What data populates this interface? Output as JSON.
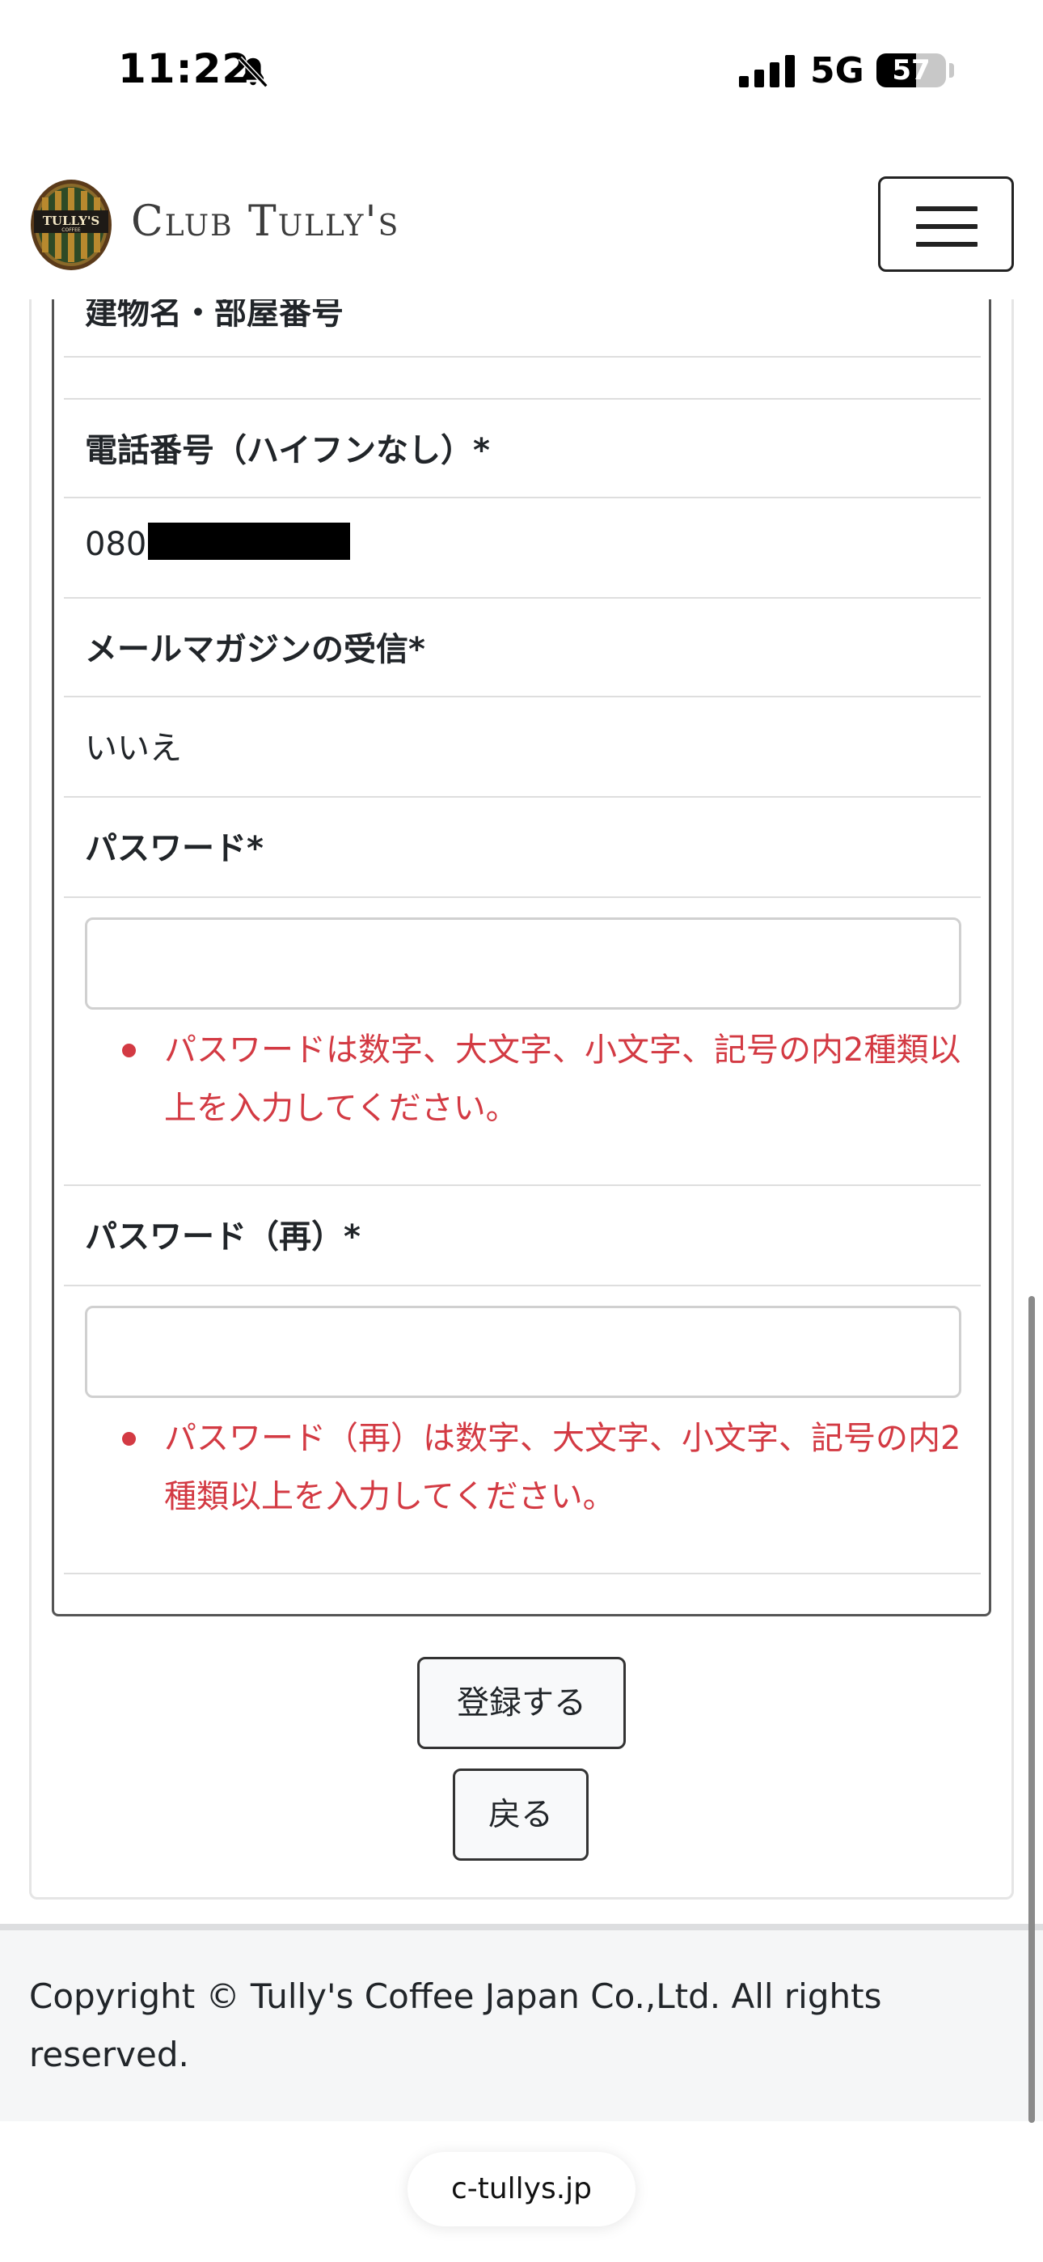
{
  "status_bar": {
    "time": "11:22",
    "network": "5G",
    "battery": "57",
    "battery_level": 0.57
  },
  "header": {
    "brand": "Club Tully's",
    "logo_text": "TULLY'S COFFEE"
  },
  "form": {
    "building_label": "建物名・部屋番号",
    "phone_label": "電話番号（ハイフンなし）*",
    "phone_value": "080",
    "newsletter_label": "メールマガジンの受信*",
    "newsletter_value": "いいえ",
    "password_label": "パスワード*",
    "password_error": "パスワードは数字、大文字、小文字、記号の内2種類以上を入力してください。",
    "password_confirm_label": "パスワード（再）*",
    "password_confirm_error": "パスワード（再）は数字、大文字、小文字、記号の内2種類以上を入力してください。"
  },
  "buttons": {
    "register": "登録する",
    "back": "戻る"
  },
  "footer": {
    "copyright": "Copyright © Tully's Coffee Japan Co.,Ltd. All rights reserved."
  },
  "browser": {
    "url": "c-tullys.jp"
  },
  "colors": {
    "error": "#d33a43",
    "border": "#555555",
    "footer_bg": "#f5f6f7"
  }
}
